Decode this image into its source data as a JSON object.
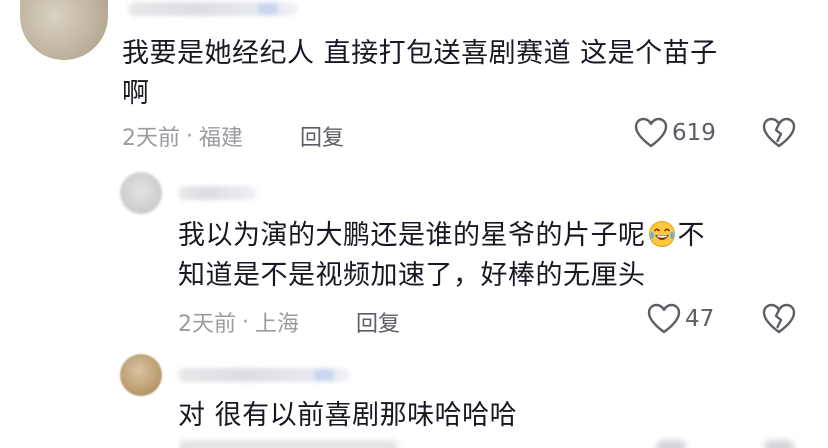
{
  "comments": [
    {
      "text_line1": "我要是她经纪人 直接打包送喜剧赛道 这是个苗子",
      "text_line2": "啊",
      "time": "2天前",
      "location": "福建",
      "reply_label": "回复",
      "likes": "619"
    },
    {
      "text_line1_a": "我以为演的大鹏还是谁的星爷的片子呢",
      "text_line1_b": "不",
      "text_line2": "知道是不是视频加速了，好棒的无厘头",
      "emoji_icon": "laughing-crying-emoji",
      "time": "2天前",
      "location": "上海",
      "reply_label": "回复",
      "likes": "47"
    },
    {
      "text_line1": "对 很有以前喜剧那味哈哈哈"
    }
  ],
  "separator": "·"
}
